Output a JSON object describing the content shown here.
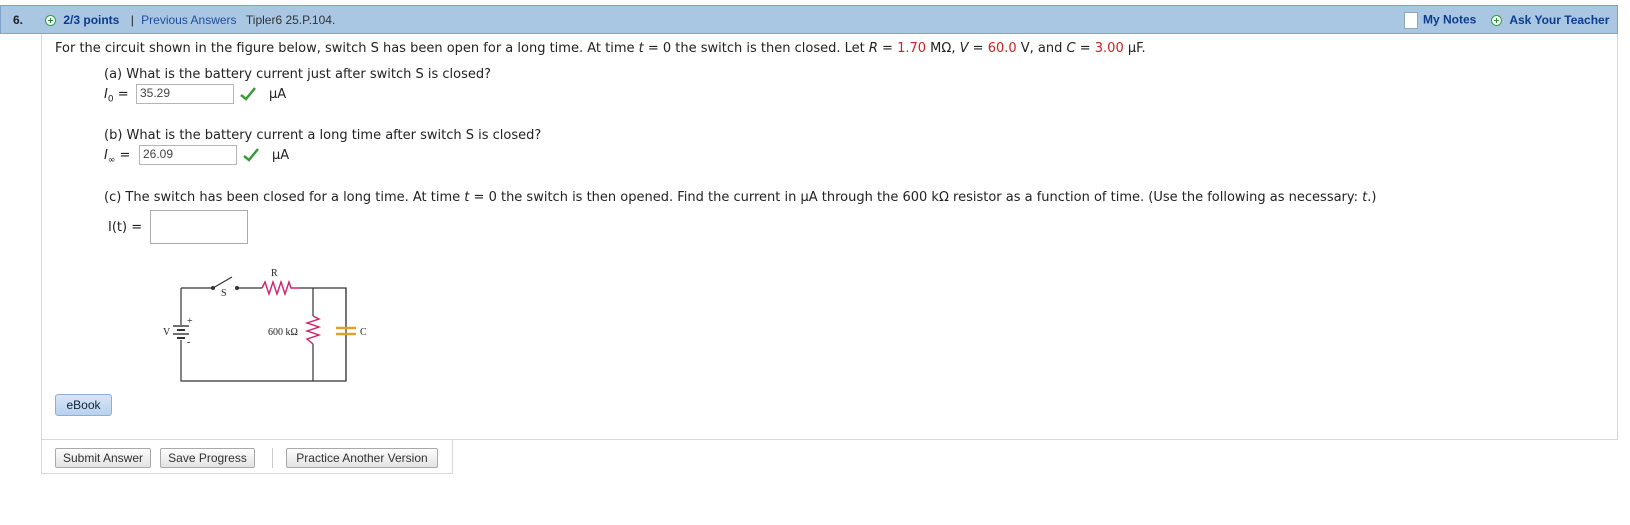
{
  "header": {
    "question_number": "6.",
    "points": "2/3 points",
    "separator": "|",
    "previous_answers": "Previous Answers",
    "reference": "Tipler6 25.P.104.",
    "my_notes": "My Notes",
    "ask_teacher": "Ask Your Teacher"
  },
  "problem": {
    "intro_part1": "For the circuit shown in the figure below, switch S has been open for a long time. At time ",
    "t_var": "t",
    "intro_part2": " = 0 the switch is then closed. Let ",
    "R_var": "R",
    "intro_part3": " = ",
    "R_value": "1.70",
    "R_unit": " MΩ, ",
    "V_var": "V",
    "intro_part4": " = ",
    "V_value": "60.0",
    "V_unit": " V, and ",
    "C_var": "C",
    "intro_part5": " = ",
    "C_value": "3.00",
    "C_unit": " µF."
  },
  "part_a": {
    "question": "(a) What is the battery current just after switch S is closed?",
    "symbol": "I",
    "subscript": "0",
    "equals": "=",
    "answer": "35.29",
    "unit": "µA"
  },
  "part_b": {
    "question": "(b) What is the battery current a long time after switch S is closed?",
    "symbol": "I",
    "subscript": "∞",
    "equals": "=",
    "answer": "26.09",
    "unit": "µA"
  },
  "part_c": {
    "question_part1": "(c) The switch has been closed for a long time. At time ",
    "t_var": "t",
    "question_part2": " = 0 the switch is then opened. Find the current in µA through the 600 kΩ resistor as a function of time. (Use the following as necessary: ",
    "t_var2": "t",
    "question_part3": ".)",
    "label": "I(t) =",
    "answer": ""
  },
  "figure": {
    "R_label": "R",
    "S_label": "S",
    "V_label": "V",
    "plus_label": "+",
    "minus_label": "-",
    "resistor_label": "600 kΩ",
    "C_label": "C",
    "resistor_color": "#d1206b",
    "capacitor_color": "#e0a030",
    "wire_color": "#333333"
  },
  "buttons": {
    "ebook": "eBook",
    "submit": "Submit Answer",
    "save": "Save Progress",
    "practice": "Practice Another Version"
  },
  "status": {
    "correct_color": "#3a9a3a"
  }
}
